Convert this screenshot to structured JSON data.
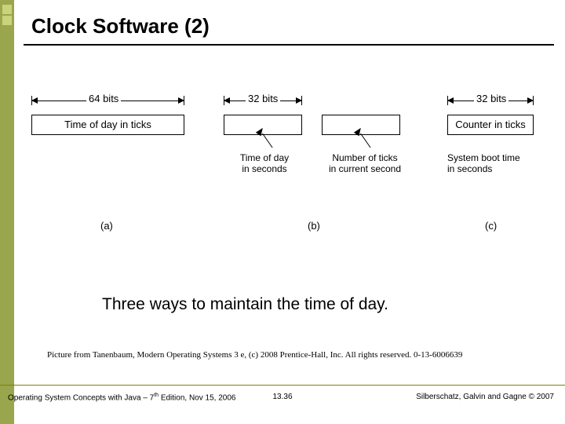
{
  "title": "Clock Software (2)",
  "figure": {
    "a": {
      "bits": "64 bits",
      "box": "Time of day in ticks",
      "sub": "(a)"
    },
    "b": {
      "bits": "32 bits",
      "box1_caption_l1": "Time of day",
      "box1_caption_l2": "in seconds",
      "box2_caption_l1": "Number of ticks",
      "box2_caption_l2": "in current second",
      "sub": "(b)"
    },
    "c": {
      "bits": "32 bits",
      "box": "Counter in ticks",
      "caption_l1": "System boot time",
      "caption_l2": "in seconds",
      "sub": "(c)"
    }
  },
  "main_caption": "Three ways to maintain the time of day.",
  "citation": "Picture from Tanenbaum, Modern Operating Systems 3 e, (c) 2008 Prentice-Hall, Inc. All rights reserved. 0-13-6006639",
  "footer": {
    "left_pre": "Operating System Concepts with Java – 7",
    "left_sup": "th",
    "left_post": " Edition, Nov 15, 2006",
    "mid": "13.36",
    "right": "Silberschatz, Galvin and Gagne © 2007"
  }
}
